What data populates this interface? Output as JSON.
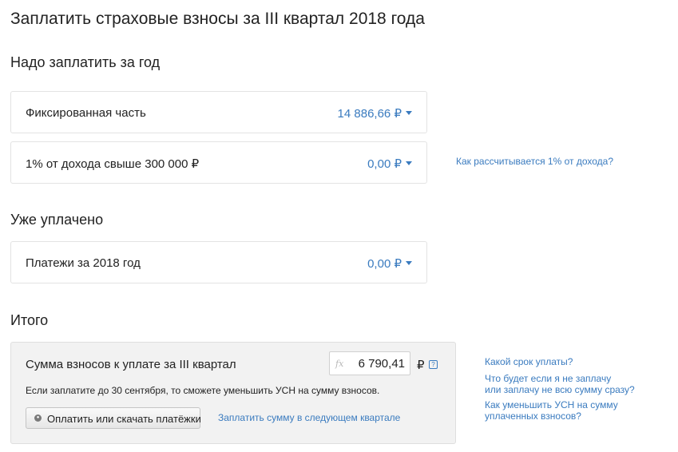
{
  "page_title": "Заплатить страховые взносы за III квартал 2018 года",
  "section_due": {
    "title": "Надо заплатить за год",
    "rows": [
      {
        "label": "Фиксированная часть",
        "value": "14 886,66 ₽"
      },
      {
        "label": "1% от дохода свыше 300 000 ₽",
        "value": "0,00 ₽"
      }
    ],
    "help_link": "Как рассчитывается 1% от дохода?"
  },
  "section_paid": {
    "title": "Уже уплачено",
    "rows": [
      {
        "label": "Платежи за 2018 год",
        "value": "0,00 ₽"
      }
    ]
  },
  "section_total": {
    "title": "Итого",
    "label": "Сумма взносов к уплате за III квартал",
    "fx_icon": "fx",
    "amount": "6 790,41",
    "currency": "₽",
    "help_icon": "?",
    "hint": "Если заплатите до 30 сентября, то сможете уменьшить УСН на сумму взносов.",
    "pay_button_label": "Оплатить или скачать платёжки",
    "next_quarter_link": "Заплатить сумму в следующем квартале"
  },
  "side_links": {
    "deadline_link": "Какой срок уплаты?",
    "nopay_link_line1": "Что будет если я не заплачу",
    "nopay_link_line2": "или заплачу не всю сумму сразу?",
    "reduce_link_line1": "Как уменьшить УСН на сумму",
    "reduce_link_line2": "уплаченных взносов?"
  },
  "colors": {
    "link": "#3a7bbf",
    "text": "#222222",
    "total_bg": "#f2f2f2"
  }
}
